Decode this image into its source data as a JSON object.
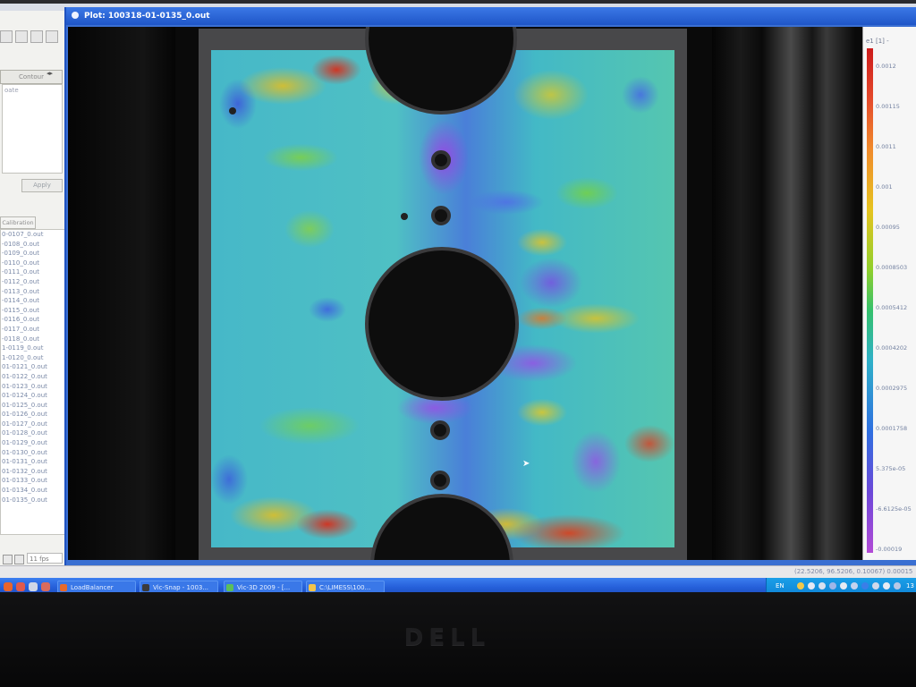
{
  "window": {
    "title": "Plot: 100318-01-0135_0.out"
  },
  "left_panel": {
    "contour_tab": "Contour",
    "frame_text": "oate",
    "apply_label": "Apply",
    "calibration_tab": "Calibration",
    "files": [
      "0-0107_0.out",
      "-0108_0.out",
      "-0109_0.out",
      "-0110_0.out",
      "-0111_0.out",
      "-0112_0.out",
      "-0113_0.out",
      "-0114_0.out",
      "-0115_0.out",
      "-0116_0.out",
      "-0117_0.out",
      "-0118_0.out",
      "1-0119_0.out",
      "1-0120_0.out",
      "01-0121_0.out",
      "01-0122_0.out",
      "01-0123_0.out",
      "01-0124_0.out",
      "01-0125_0.out",
      "01-0126_0.out",
      "01-0127_0.out",
      "01-0128_0.out",
      "01-0129_0.out",
      "01-0130_0.out",
      "01-0131_0.out",
      "01-0132_0.out",
      "01-0133_0.out",
      "01-0134_0.out",
      "01-0135_0.out"
    ],
    "fps_value": "11 fps"
  },
  "legend": {
    "title": "e1 [1] -",
    "ticks": [
      "0.0012",
      "0.00115",
      "0.0011",
      "0.001",
      "0.00095",
      "0.0008503",
      "0.0005412",
      "0.0004202",
      "0.0002975",
      "0.0001758",
      "5.375e-05",
      "-6.6125e-05",
      "-0.00019"
    ]
  },
  "status": {
    "coords": "(22.5206, 96.5206, 0.10067) 0.00015"
  },
  "taskbar": {
    "buttons": [
      {
        "label": "LoadBalancer",
        "color": "#e66a2c"
      },
      {
        "label": "Vic-Snap - 1003...",
        "color": "#3b3b3b"
      },
      {
        "label": "Vic-3D 2009 - [...",
        "color": "#5cbf5a"
      },
      {
        "label": "C:\\LIMESS\\100...",
        "color": "#f2c44c"
      }
    ],
    "tray_lang": "EN",
    "clock": "13"
  },
  "monitor": {
    "brand": "DELL"
  },
  "colors": {
    "titlebar": "#2a62d8",
    "accent": "#3a78e8"
  }
}
